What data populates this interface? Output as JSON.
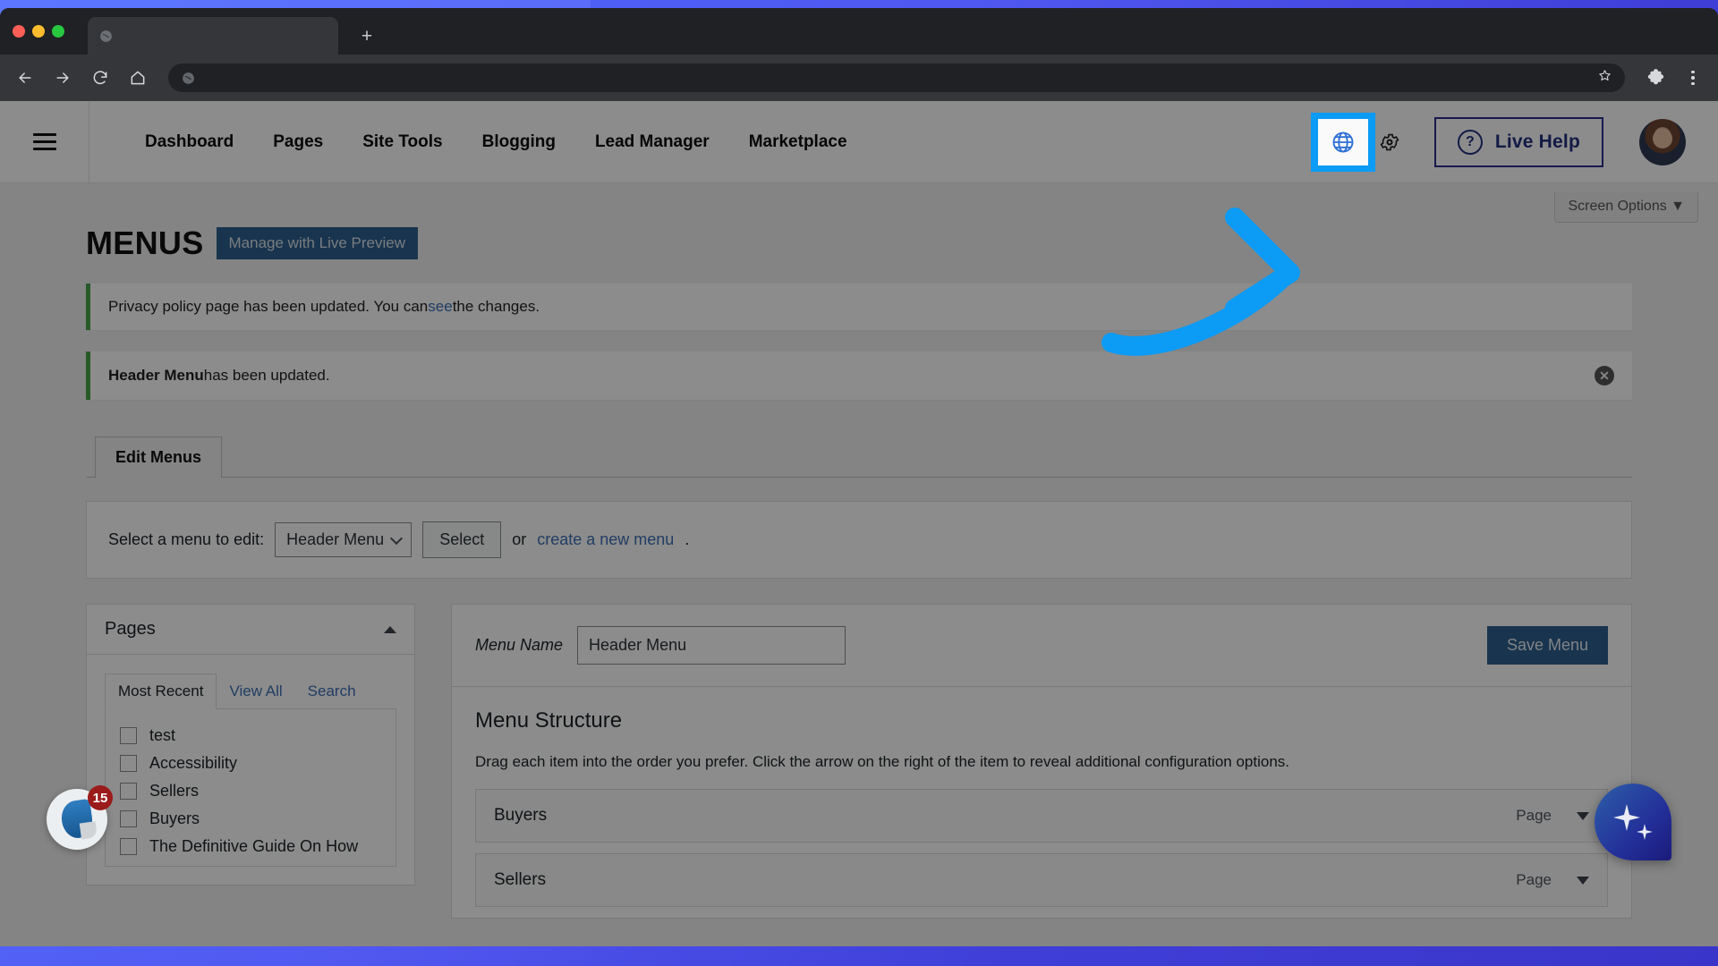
{
  "browser": {
    "tab": {
      "title": "",
      "favicon_icon": "globe-icon"
    },
    "new_tab_label": "+",
    "address_value": "",
    "address_placeholder": "",
    "icons": {
      "back": "back-arrow-icon",
      "forward": "forward-arrow-icon",
      "reload": "reload-icon",
      "home": "home-icon",
      "bookmark": "star-icon",
      "extensions": "puzzle-piece-icon",
      "menu": "three-dot-menu-icon"
    }
  },
  "appnav": {
    "menu_icon": "hamburger-menu-icon",
    "links": [
      {
        "label": "Dashboard"
      },
      {
        "label": "Pages"
      },
      {
        "label": "Site Tools"
      },
      {
        "label": "Blogging"
      },
      {
        "label": "Lead Manager"
      },
      {
        "label": "Marketplace"
      }
    ],
    "globe_button": {
      "icon": "globe-icon",
      "highlight_color": "#0c9bf5"
    },
    "gear_button": {
      "icon": "gear-icon"
    },
    "live_help": {
      "label": "Live Help",
      "icon": "question-mark-circle-icon",
      "color": "#23307e"
    },
    "avatar": {
      "name": "user-avatar"
    }
  },
  "wp": {
    "screen_options": "Screen Options ▼",
    "page_title": "MENUS",
    "preview_button": "Manage with Live Preview",
    "notices": [
      {
        "text_before": "Privacy policy page has been updated. You can ",
        "link": "see",
        "text_after": " the changes.",
        "dismissible": false
      },
      {
        "bold": "Header Menu",
        "text_after": " has been updated.",
        "dismissible": true,
        "dismiss_label": "✕"
      }
    ],
    "tabs": [
      {
        "label": "Edit Menus",
        "active": true
      }
    ],
    "select_bar": {
      "label": "Select a menu to edit:",
      "selected_menu": "Header Menu",
      "select_button": "Select",
      "or_text": "or ",
      "create_link": "create a new menu",
      "period": "."
    },
    "pages_panel": {
      "title": "Pages",
      "collapse_icon": "caret-up-icon",
      "tabs": [
        {
          "label": "Most Recent",
          "active": true
        },
        {
          "label": "View All",
          "active": false
        },
        {
          "label": "Search",
          "active": false
        }
      ],
      "items": [
        {
          "label": "test",
          "checked": false
        },
        {
          "label": "Accessibility",
          "checked": false
        },
        {
          "label": "Sellers",
          "checked": false
        },
        {
          "label": "Buyers",
          "checked": false
        },
        {
          "label": "The Definitive Guide On How",
          "checked": false
        }
      ]
    },
    "menu_editor": {
      "menu_name_label": "Menu Name",
      "menu_name_value": "Header Menu",
      "save_button": "Save Menu",
      "structure_title": "Menu Structure",
      "structure_help": "Drag each item into the order you prefer. Click the arrow on the right of the item to reveal additional configuration options.",
      "items": [
        {
          "label": "Buyers",
          "type": "Page"
        },
        {
          "label": "Sellers",
          "type": "Page"
        }
      ]
    }
  },
  "widgets": {
    "flame": {
      "icon": "flame-icon",
      "badge_count": "15"
    },
    "ai_assistant": {
      "icon": "sparkles-icon"
    }
  },
  "annotation": {
    "arrow_color": "#0c9bf5",
    "points_to": "globe-button"
  }
}
